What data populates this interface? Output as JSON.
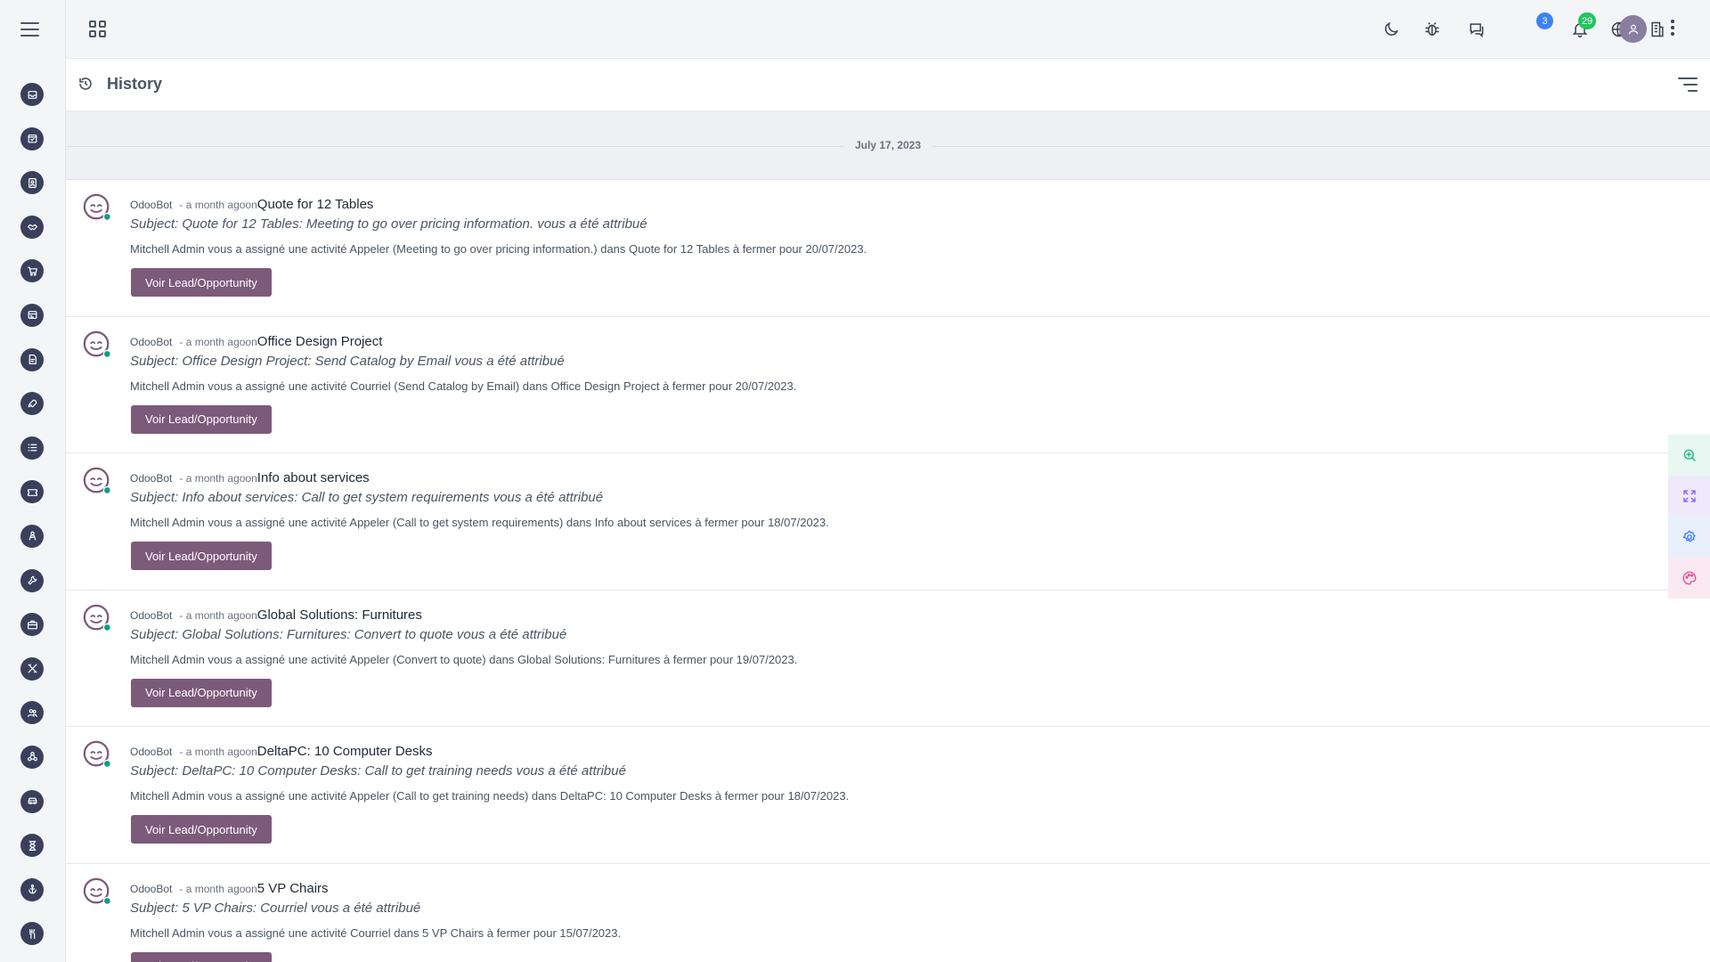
{
  "sidebar": {
    "menu_icon": "hamburger-icon",
    "items": [
      {
        "icon": "inbox-icon"
      },
      {
        "icon": "calendar-check-icon"
      },
      {
        "icon": "contacts-icon"
      },
      {
        "icon": "handshake-icon"
      },
      {
        "icon": "cart-icon"
      },
      {
        "icon": "invoice-icon"
      },
      {
        "icon": "document-icon"
      },
      {
        "icon": "rocket-icon"
      },
      {
        "icon": "list-icon"
      },
      {
        "icon": "ticket-icon"
      },
      {
        "icon": "recruit-icon"
      },
      {
        "icon": "tool-icon"
      },
      {
        "icon": "briefcase-icon"
      },
      {
        "icon": "crossed-tools-icon"
      },
      {
        "icon": "people-icon"
      },
      {
        "icon": "network-icon"
      },
      {
        "icon": "car-icon"
      },
      {
        "icon": "hourglass-icon"
      },
      {
        "icon": "anchor-icon"
      },
      {
        "icon": "utensils-icon"
      }
    ]
  },
  "topbar": {
    "apps_icon": "apps-grid-icon",
    "icons": [
      "moon-icon",
      "bug-icon",
      "chat-icon",
      "bell-icon",
      "globe-icon",
      "building-icon"
    ],
    "chat_badge": "3",
    "notification_badge": "29",
    "colors": {
      "chat_badge": "#3b82f6",
      "notification_badge": "#22c55e"
    }
  },
  "page": {
    "title": "History",
    "title_icon": "history-icon",
    "filter_icon": "filter-lines-icon"
  },
  "date_separator": "July 17, 2023",
  "messages": [
    {
      "author": "OdooBot",
      "time": "- a month agoon",
      "record": "Quote for 12 Tables",
      "subject": "Subject: Quote for 12 Tables: Meeting to go over pricing information. vous a été attribué",
      "body": "Mitchell Admin vous a assigné une activité Appeler (Meeting to go over pricing information.) dans Quote for 12 Tables à fermer pour 20/07/2023.",
      "button": "Voir Lead/Opportunity"
    },
    {
      "author": "OdooBot",
      "time": "- a month agoon",
      "record": "Office Design Project",
      "subject": "Subject: Office Design Project: Send Catalog by Email vous a été attribué",
      "body": "Mitchell Admin vous a assigné une activité Courriel (Send Catalog by Email) dans Office Design Project à fermer pour 20/07/2023.",
      "button": "Voir Lead/Opportunity"
    },
    {
      "author": "OdooBot",
      "time": "- a month agoon",
      "record": "Info about services",
      "subject": "Subject: Info about services: Call to get system requirements vous a été attribué",
      "body": "Mitchell Admin vous a assigné une activité Appeler (Call to get system requirements) dans Info about services à fermer pour 18/07/2023.",
      "button": "Voir Lead/Opportunity"
    },
    {
      "author": "OdooBot",
      "time": "- a month agoon",
      "record": "Global Solutions: Furnitures",
      "subject": "Subject: Global Solutions: Furnitures: Convert to quote vous a été attribué",
      "body": "Mitchell Admin vous a assigné une activité Appeler (Convert to quote) dans Global Solutions: Furnitures à fermer pour 19/07/2023.",
      "button": "Voir Lead/Opportunity"
    },
    {
      "author": "OdooBot",
      "time": "- a month agoon",
      "record": "DeltaPC: 10 Computer Desks",
      "subject": "Subject: DeltaPC: 10 Computer Desks: Call to get training needs vous a été attribué",
      "body": "Mitchell Admin vous a assigné une activité Appeler (Call to get training needs) dans DeltaPC: 10 Computer Desks à fermer pour 18/07/2023.",
      "button": "Voir Lead/Opportunity"
    },
    {
      "author": "OdooBot",
      "time": "- a month agoon",
      "record": "5 VP Chairs",
      "subject": "Subject: 5 VP Chairs: Courriel vous a été attribué",
      "body": "Mitchell Admin vous a assigné une activité Courriel dans 5 VP Chairs à fermer pour 15/07/2023.",
      "button": "Voir Lead/Opportunity"
    }
  ],
  "float_tools": [
    {
      "icon": "zoom-in-icon",
      "color": "#10b981",
      "bg": "#e8f7f1"
    },
    {
      "icon": "expand-icon",
      "color": "#8b5cf6",
      "bg": "#efeafb"
    },
    {
      "icon": "settings-icon",
      "color": "#3b82f6",
      "bg": "#e8effb"
    },
    {
      "icon": "palette-icon",
      "color": "#ec4899",
      "bg": "#fbe9f1"
    }
  ],
  "colors": {
    "button": "#7c5a7a",
    "sidebar_icon_bg": "#3b3f5c",
    "avatar_online": "#0f9d8a"
  }
}
